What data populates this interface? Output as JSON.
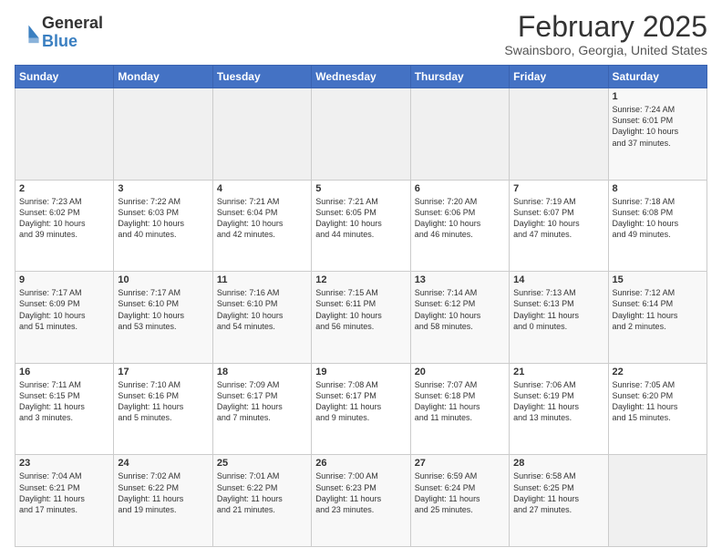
{
  "header": {
    "logo_general": "General",
    "logo_blue": "Blue",
    "month": "February 2025",
    "location": "Swainsboro, Georgia, United States"
  },
  "weekdays": [
    "Sunday",
    "Monday",
    "Tuesday",
    "Wednesday",
    "Thursday",
    "Friday",
    "Saturday"
  ],
  "weeks": [
    [
      {
        "day": "",
        "info": ""
      },
      {
        "day": "",
        "info": ""
      },
      {
        "day": "",
        "info": ""
      },
      {
        "day": "",
        "info": ""
      },
      {
        "day": "",
        "info": ""
      },
      {
        "day": "",
        "info": ""
      },
      {
        "day": "1",
        "info": "Sunrise: 7:24 AM\nSunset: 6:01 PM\nDaylight: 10 hours\nand 37 minutes."
      }
    ],
    [
      {
        "day": "2",
        "info": "Sunrise: 7:23 AM\nSunset: 6:02 PM\nDaylight: 10 hours\nand 39 minutes."
      },
      {
        "day": "3",
        "info": "Sunrise: 7:22 AM\nSunset: 6:03 PM\nDaylight: 10 hours\nand 40 minutes."
      },
      {
        "day": "4",
        "info": "Sunrise: 7:21 AM\nSunset: 6:04 PM\nDaylight: 10 hours\nand 42 minutes."
      },
      {
        "day": "5",
        "info": "Sunrise: 7:21 AM\nSunset: 6:05 PM\nDaylight: 10 hours\nand 44 minutes."
      },
      {
        "day": "6",
        "info": "Sunrise: 7:20 AM\nSunset: 6:06 PM\nDaylight: 10 hours\nand 46 minutes."
      },
      {
        "day": "7",
        "info": "Sunrise: 7:19 AM\nSunset: 6:07 PM\nDaylight: 10 hours\nand 47 minutes."
      },
      {
        "day": "8",
        "info": "Sunrise: 7:18 AM\nSunset: 6:08 PM\nDaylight: 10 hours\nand 49 minutes."
      }
    ],
    [
      {
        "day": "9",
        "info": "Sunrise: 7:17 AM\nSunset: 6:09 PM\nDaylight: 10 hours\nand 51 minutes."
      },
      {
        "day": "10",
        "info": "Sunrise: 7:17 AM\nSunset: 6:10 PM\nDaylight: 10 hours\nand 53 minutes."
      },
      {
        "day": "11",
        "info": "Sunrise: 7:16 AM\nSunset: 6:10 PM\nDaylight: 10 hours\nand 54 minutes."
      },
      {
        "day": "12",
        "info": "Sunrise: 7:15 AM\nSunset: 6:11 PM\nDaylight: 10 hours\nand 56 minutes."
      },
      {
        "day": "13",
        "info": "Sunrise: 7:14 AM\nSunset: 6:12 PM\nDaylight: 10 hours\nand 58 minutes."
      },
      {
        "day": "14",
        "info": "Sunrise: 7:13 AM\nSunset: 6:13 PM\nDaylight: 11 hours\nand 0 minutes."
      },
      {
        "day": "15",
        "info": "Sunrise: 7:12 AM\nSunset: 6:14 PM\nDaylight: 11 hours\nand 2 minutes."
      }
    ],
    [
      {
        "day": "16",
        "info": "Sunrise: 7:11 AM\nSunset: 6:15 PM\nDaylight: 11 hours\nand 3 minutes."
      },
      {
        "day": "17",
        "info": "Sunrise: 7:10 AM\nSunset: 6:16 PM\nDaylight: 11 hours\nand 5 minutes."
      },
      {
        "day": "18",
        "info": "Sunrise: 7:09 AM\nSunset: 6:17 PM\nDaylight: 11 hours\nand 7 minutes."
      },
      {
        "day": "19",
        "info": "Sunrise: 7:08 AM\nSunset: 6:17 PM\nDaylight: 11 hours\nand 9 minutes."
      },
      {
        "day": "20",
        "info": "Sunrise: 7:07 AM\nSunset: 6:18 PM\nDaylight: 11 hours\nand 11 minutes."
      },
      {
        "day": "21",
        "info": "Sunrise: 7:06 AM\nSunset: 6:19 PM\nDaylight: 11 hours\nand 13 minutes."
      },
      {
        "day": "22",
        "info": "Sunrise: 7:05 AM\nSunset: 6:20 PM\nDaylight: 11 hours\nand 15 minutes."
      }
    ],
    [
      {
        "day": "23",
        "info": "Sunrise: 7:04 AM\nSunset: 6:21 PM\nDaylight: 11 hours\nand 17 minutes."
      },
      {
        "day": "24",
        "info": "Sunrise: 7:02 AM\nSunset: 6:22 PM\nDaylight: 11 hours\nand 19 minutes."
      },
      {
        "day": "25",
        "info": "Sunrise: 7:01 AM\nSunset: 6:22 PM\nDaylight: 11 hours\nand 21 minutes."
      },
      {
        "day": "26",
        "info": "Sunrise: 7:00 AM\nSunset: 6:23 PM\nDaylight: 11 hours\nand 23 minutes."
      },
      {
        "day": "27",
        "info": "Sunrise: 6:59 AM\nSunset: 6:24 PM\nDaylight: 11 hours\nand 25 minutes."
      },
      {
        "day": "28",
        "info": "Sunrise: 6:58 AM\nSunset: 6:25 PM\nDaylight: 11 hours\nand 27 minutes."
      },
      {
        "day": "",
        "info": ""
      }
    ]
  ]
}
